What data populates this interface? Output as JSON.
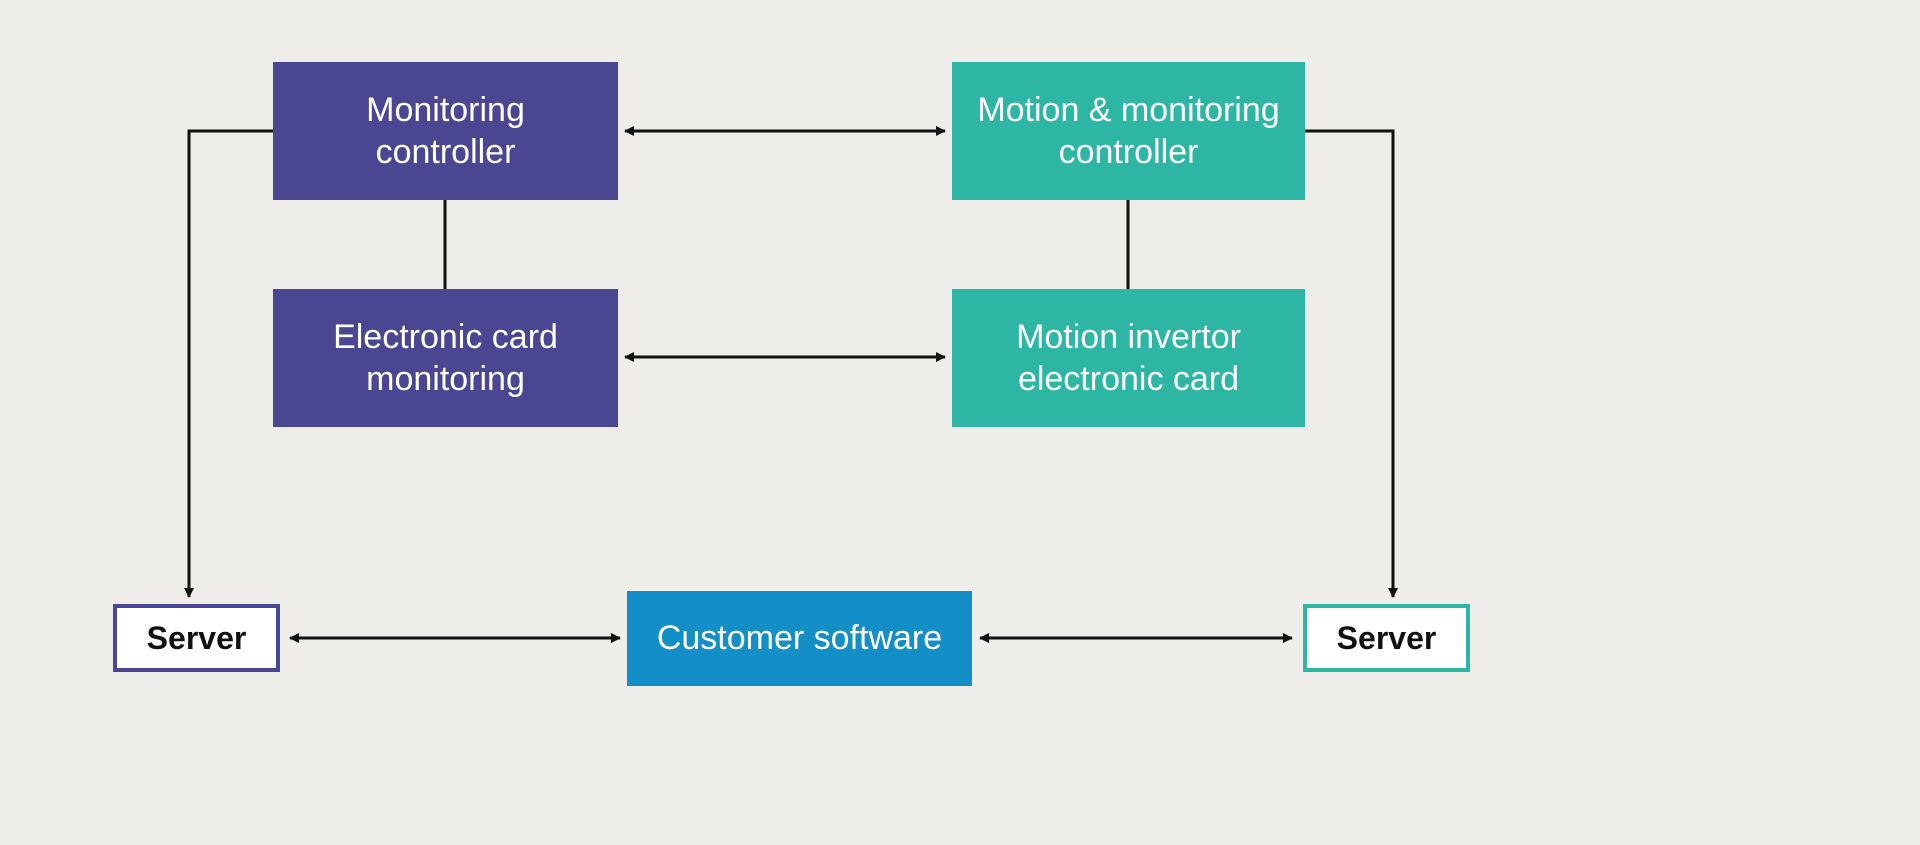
{
  "colors": {
    "background": "#eeedea",
    "purple": "#4b4692",
    "teal": "#2db6a3",
    "blue": "#138ec6",
    "line": "#111"
  },
  "boxes": {
    "monitoring_controller": "Monitoring controller",
    "motion_monitoring_controller": "Motion & monitoring controller",
    "electronic_card_monitoring": "Electronic card monitoring",
    "motion_invertor_electronic_card": "Motion invertor electronic card",
    "customer_software": "Customer software",
    "server_left": "Server",
    "server_right": "Server"
  }
}
